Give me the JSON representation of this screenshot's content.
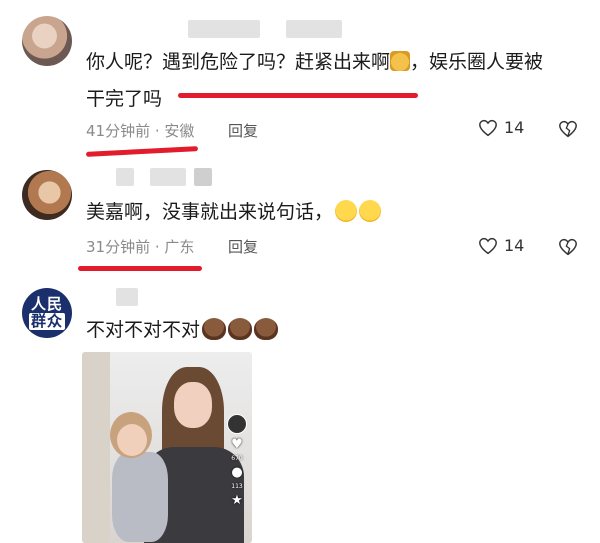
{
  "comments": [
    {
      "text": "你人呢？遇到危险了吗？赶紧出来啊",
      "text2": "，娱乐圈人要被",
      "text3": "干完了吗",
      "time": "41分钟前 · 安徽",
      "reply": "回复",
      "likes": "14",
      "emoji": [
        "cat-face-emoji"
      ]
    },
    {
      "text": "美嘉啊，没事就出来说句话，",
      "time": "31分钟前 · 广东",
      "reply": "回复",
      "likes": "14",
      "emoji": [
        "crying-face-emoji",
        "crying-face-emoji"
      ]
    },
    {
      "avatar_line1": "人民",
      "avatar_line2": "群众",
      "text": "不对不对不对",
      "emoji": [
        "poop-emoji",
        "poop-emoji",
        "poop-emoji"
      ]
    }
  ],
  "video": {
    "like_count": "670",
    "comment_count": "113"
  },
  "colors": {
    "underline": "#e21c2c",
    "meta_text": "#8a8a8a",
    "avatar_blue": "#1a2f6b"
  },
  "icons": [
    "heart-icon",
    "dislike-icon"
  ]
}
